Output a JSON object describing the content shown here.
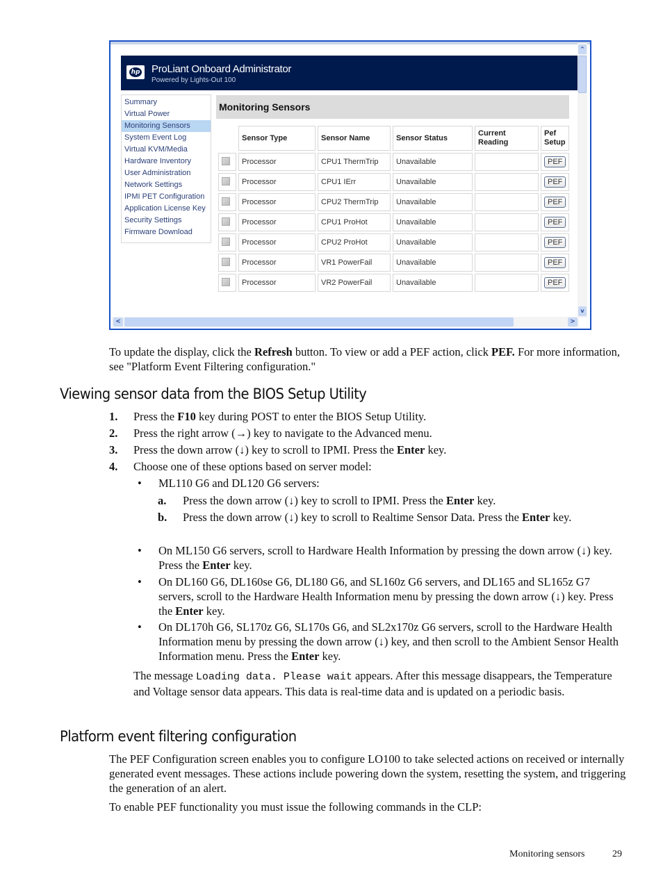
{
  "screenshot": {
    "banner": {
      "logo": "hp",
      "title": "ProLiant Onboard Administrator",
      "subtitle": "Powered by Lights-Out 100"
    },
    "nav": [
      {
        "label": "Summary",
        "active": false
      },
      {
        "label": "Virtual Power",
        "active": false
      },
      {
        "label": "Monitoring Sensors",
        "active": true
      },
      {
        "label": "System Event Log",
        "active": false
      },
      {
        "label": "Virtual KVM/Media",
        "active": false
      },
      {
        "label": "Hardware Inventory",
        "active": false
      },
      {
        "label": "User Administration",
        "active": false
      },
      {
        "label": "Network Settings",
        "active": false
      },
      {
        "label": "IPMI PET Configuration",
        "active": false
      },
      {
        "label": "Application License Key",
        "active": false
      },
      {
        "label": "Security Settings",
        "active": false
      },
      {
        "label": "Firmware Download",
        "active": false
      }
    ],
    "page_heading": "Monitoring Sensors",
    "table": {
      "headers": [
        "Sensor Type",
        "Sensor Name",
        "Sensor Status",
        "Current Reading",
        "Pef Setup"
      ],
      "header_lines": {
        "reading": [
          "Current",
          "Reading"
        ],
        "pef": [
          "Pef",
          "Setup"
        ]
      },
      "pef_label": "PEF",
      "rows": [
        {
          "type": "Processor",
          "name": "CPU1 ThermTrip",
          "status": "Unavailable",
          "reading": ""
        },
        {
          "type": "Processor",
          "name": "CPU1 IErr",
          "status": "Unavailable",
          "reading": ""
        },
        {
          "type": "Processor",
          "name": "CPU2 ThermTrip",
          "status": "Unavailable",
          "reading": ""
        },
        {
          "type": "Processor",
          "name": "CPU1 ProHot",
          "status": "Unavailable",
          "reading": ""
        },
        {
          "type": "Processor",
          "name": "CPU2 ProHot",
          "status": "Unavailable",
          "reading": ""
        },
        {
          "type": "Processor",
          "name": "VR1 PowerFail",
          "status": "Unavailable",
          "reading": ""
        },
        {
          "type": "Processor",
          "name": "VR2 PowerFail",
          "status": "Unavailable",
          "reading": ""
        }
      ]
    },
    "scroll": {
      "up": "^",
      "down": "v",
      "left": "<",
      "right": ">"
    }
  },
  "doc": {
    "intro": {
      "t1": "To update the display, click the ",
      "b1": "Refresh",
      "t2": " button. To view or add a PEF action, click ",
      "b2": "PEF.",
      "t3": " For more information, see \"Platform Event Filtering configuration.\""
    },
    "section1_title": "Viewing sensor data from the BIOS Setup Utility",
    "steps": [
      {
        "num": "1.",
        "pre": "Press the ",
        "bold": "F10",
        "post": " key during POST to enter the BIOS Setup Utility."
      },
      {
        "num": "2.",
        "pre": "Press the right arrow (→) key to navigate to the Advanced menu.",
        "bold": "",
        "post": ""
      },
      {
        "num": "3.",
        "pre": "Press the down arrow (↓) key to scroll to IPMI. Press the ",
        "bold": "Enter",
        "post": " key."
      },
      {
        "num": "4.",
        "pre": "Choose one of these options based on server model:",
        "bold": "",
        "post": ""
      }
    ],
    "bullets": [
      {
        "pre": "ML110 G6 and DL120 G6 servers:",
        "bold": "",
        "post": ""
      },
      {
        "pre": "On ML150 G6 servers, scroll to Hardware Health Information by pressing the down arrow (↓) key. Press the ",
        "bold": "Enter",
        "post": " key."
      },
      {
        "pre": "On DL160 G6, DL160se G6, DL180 G6, and SL160z G6 servers, and DL165 and SL165z G7 servers, scroll to the Hardware Health Information menu by pressing the down arrow (↓) key. Press the ",
        "bold": "Enter",
        "post": " key."
      },
      {
        "pre": "On DL170h G6, SL170z G6, SL170s G6, and SL2x170z G6 servers, scroll to the Hardware Health Information menu by pressing the down arrow (↓) key, and then scroll to the Ambient Sensor Health Information menu. Press the ",
        "bold": "Enter",
        "post": " key."
      }
    ],
    "substeps": [
      {
        "num": "a.",
        "pre": "Press the down arrow (↓) key to scroll to IPMI. Press the ",
        "bold": "Enter",
        "post": " key."
      },
      {
        "num": "b.",
        "pre": "Press the down arrow (↓) key to scroll to Realtime Sensor Data. Press the ",
        "bold": "Enter",
        "post": " key."
      }
    ],
    "loading": {
      "pre": "The message ",
      "code": "Loading data. Please wait",
      "post": " appears. After this message disappears, the Temperature and Voltage sensor data appears. This data is real-time data and is updated on a periodic basis."
    },
    "section2_title": "Platform event filtering configuration",
    "pef_para": "The PEF Configuration screen enables you to configure LO100 to take selected actions on received or internally generated event messages. These actions include powering down the system, resetting the system, and triggering the generation of an alert.",
    "clp_para": "To enable PEF functionality you must issue the following commands in the CLP:",
    "footer": {
      "section": "Monitoring sensors",
      "page": "29"
    }
  }
}
